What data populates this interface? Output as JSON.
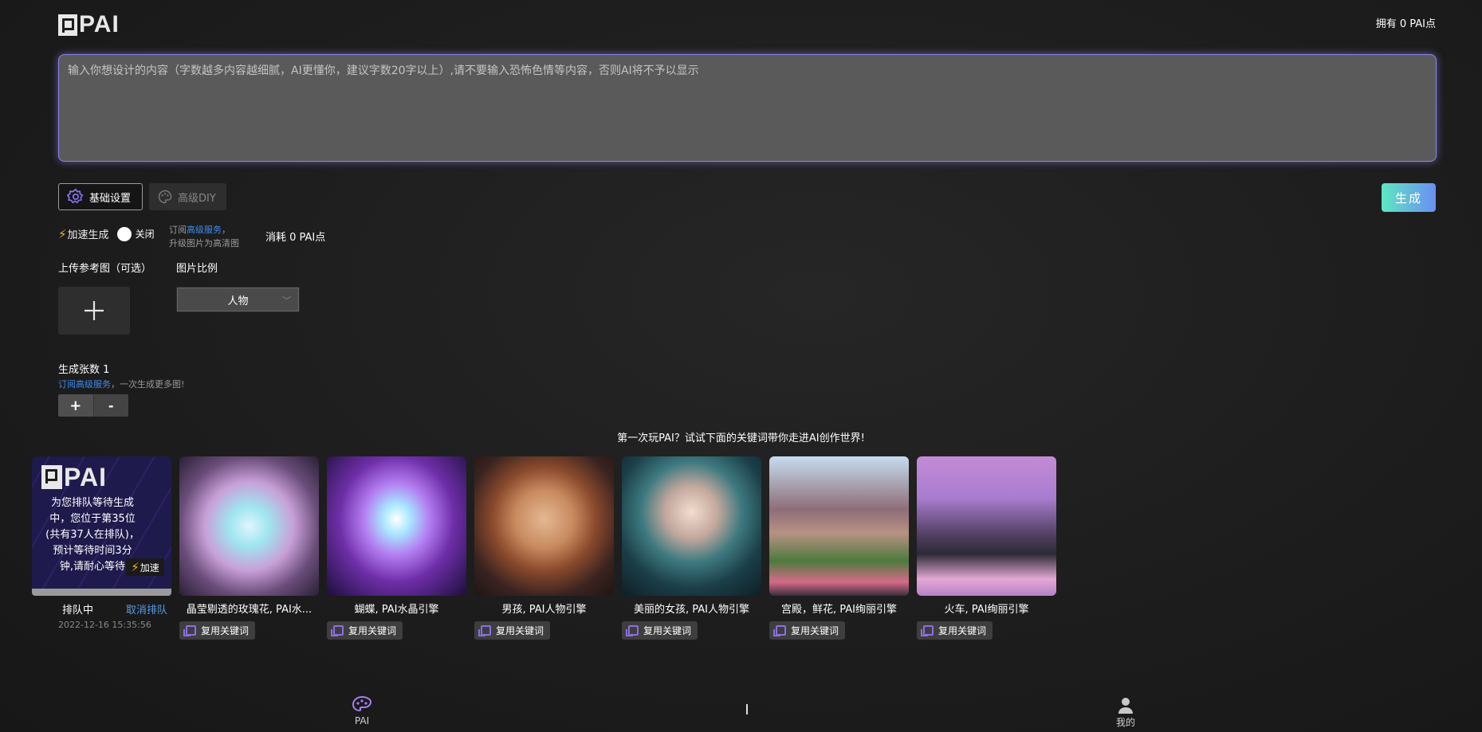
{
  "header": {
    "logo_text": "PAI",
    "points_owned": "拥有 0 PAI点"
  },
  "prompt": {
    "placeholder": "输入你想设计的内容（字数越多内容越细腻，AI更懂你，建议字数20字以上）,请不要输入恐怖色情等内容，否则AI将不予以显示"
  },
  "tabs": {
    "basic": "基础设置",
    "advanced": "高级DIY"
  },
  "generate_label": "生成",
  "speed": {
    "label": "加速生成",
    "state": "关闭",
    "note_prefix": "订阅",
    "note_link": "高级服务",
    "note_suffix": "，",
    "note_line2": "升级图片为高清图",
    "consume": "消耗 0 PAI点"
  },
  "upload": {
    "label": "上传参考图（可选）"
  },
  "ratio": {
    "label": "图片比例",
    "selected": "人物"
  },
  "count": {
    "label": "生成张数 1",
    "sub_link": "订阅高级服务",
    "sub_suffix": "，一次生成更多图!",
    "plus": "+",
    "minus": "-"
  },
  "intro": "第一次玩PAI？试试下面的关键词带你走进AI创作世界!",
  "queue": {
    "logo_text": "PAI",
    "lines": [
      "为您排队等待生成",
      "中，您位于第35位",
      "(共有37人在排队)，",
      "预计等待时间3分",
      "钟,请耐心等待"
    ],
    "speed_up": "加速",
    "status": "排队中",
    "cancel": "取消排队",
    "time": "2022-12-16 15:35:56"
  },
  "examples": [
    {
      "caption": "晶莹剔透的玫瑰花, PAI水...",
      "reuse": "复用关键词"
    },
    {
      "caption": "蝴蝶, PAI水晶引擎",
      "reuse": "复用关键词"
    },
    {
      "caption": "男孩, PAI人物引擎",
      "reuse": "复用关键词"
    },
    {
      "caption": "美丽的女孩, PAI人物引擎",
      "reuse": "复用关键词"
    },
    {
      "caption": "宫殿，鲜花, PAI绚丽引擎",
      "reuse": "复用关键词"
    },
    {
      "caption": "火车, PAI绚丽引擎",
      "reuse": "复用关键词"
    }
  ],
  "nav": {
    "pai": "PAI",
    "mine": "我的"
  },
  "colors": {
    "accent": "#8a86e6",
    "link": "#3d8cf0",
    "bolt": "#f2b616"
  }
}
